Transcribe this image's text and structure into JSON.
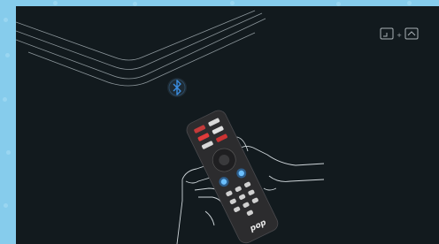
{
  "screen": {
    "icons": {
      "bluetooth": "bluetooth-icon",
      "pairing_hint": "back-plus-home-icon",
      "remote": "remote-control-icon",
      "hands": "hands-outline-icon",
      "tv_box": "tv-box-outline-icon"
    },
    "pairing_hint_separator": "+",
    "remote_brand": "pop",
    "colors": {
      "frame": "#86ccec",
      "screen": "#121a1e",
      "line": "#cfd6da",
      "bluetooth_accent": "#3a8de0",
      "button_glow": "#2e9bff",
      "remote_body": "#2c2c2e"
    }
  }
}
